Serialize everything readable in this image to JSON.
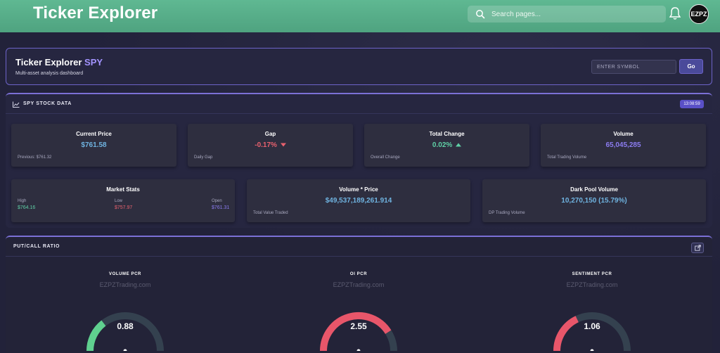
{
  "header": {
    "app_title": "Ticker Explorer",
    "search_placeholder": "Search pages...",
    "avatar_text": "EZPZ"
  },
  "hero": {
    "title": "Ticker Explorer",
    "symbol": "SPY",
    "subtitle": "Multi-asset analysis dashboard",
    "symbol_placeholder": "ENTER SYMBOL",
    "go_label": "Go"
  },
  "stock": {
    "section_title": "SPY STOCK DATA",
    "time": "13:08:59",
    "current_price": {
      "label": "Current Price",
      "value": "$761.58",
      "sub": "Previous: $761.32"
    },
    "gap": {
      "label": "Gap",
      "value": "-0.17%",
      "sub": "Daily Gap"
    },
    "total_change": {
      "label": "Total Change",
      "value": "0.02%",
      "sub": "Overall Change"
    },
    "volume": {
      "label": "Volume",
      "value": "65,045,285",
      "sub": "Total Trading Volume"
    },
    "market_stats": {
      "label": "Market Stats",
      "high_label": "High",
      "high": "$764.16",
      "low_label": "Low",
      "low": "$757.97",
      "open_label": "Open",
      "open": "$761.31"
    },
    "volume_price": {
      "label": "Volume * Price",
      "value": "$49,537,189,261.914",
      "sub": "Total Value Traded"
    },
    "dark_pool": {
      "label": "Dark Pool Volume",
      "value": "10,270,150 (15.79%)",
      "sub": "DP Trading Volume"
    }
  },
  "pcr": {
    "section_title": "PUT/CALL RATIO",
    "watermark": "EZPZTrading.com",
    "gauges": [
      {
        "title": "VOLUME PCR",
        "value": "0.88",
        "fraction": 0.29,
        "color": "#5fd08f"
      },
      {
        "title": "OI PCR",
        "value": "2.55",
        "fraction": 0.82,
        "color": "#e8566a"
      },
      {
        "title": "SENTIMENT PCR",
        "value": "1.06",
        "fraction": 0.36,
        "color": "#e8566a"
      }
    ]
  },
  "colors": {
    "header_green": "#5fb892",
    "accent_purple": "#7b70d6",
    "positive": "#5fd0a6",
    "negative": "#e8616e"
  }
}
